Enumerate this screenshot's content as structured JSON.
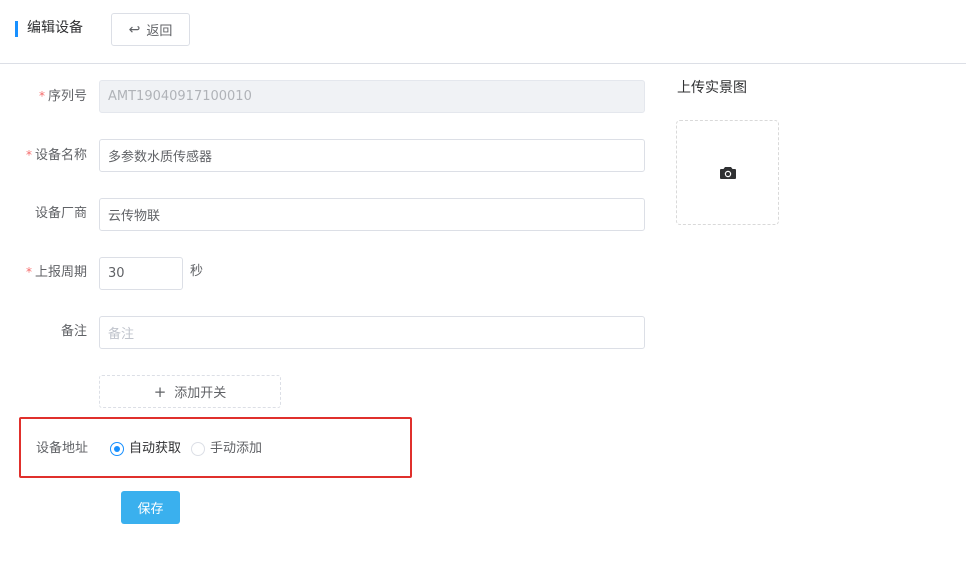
{
  "header": {
    "title": "编辑设备",
    "back_label": "返回"
  },
  "form": {
    "serial": {
      "label": "序列号",
      "required": true,
      "value": "AMT19040917100010",
      "disabled": true
    },
    "name": {
      "label": "设备名称",
      "required": true,
      "value": "多参数水质传感器"
    },
    "vendor": {
      "label": "设备厂商",
      "required": false,
      "value": "云传物联"
    },
    "period": {
      "label": "上报周期",
      "required": true,
      "value": "30",
      "unit": "秒"
    },
    "note": {
      "label": "备注",
      "required": false,
      "value": "",
      "placeholder": "备注"
    },
    "add_switch_label": "添加开关",
    "address": {
      "label": "设备地址",
      "options": [
        {
          "label": "自动获取",
          "checked": true
        },
        {
          "label": "手动添加",
          "checked": false
        }
      ]
    },
    "save_label": "保存",
    "required_mark": "*"
  },
  "upload": {
    "title": "上传实景图",
    "icon": "camera-icon"
  },
  "colors": {
    "accent": "#1890ff",
    "save_button": "#3ab0ee",
    "required": "#f56c6c",
    "highlight": "#e0302c"
  }
}
